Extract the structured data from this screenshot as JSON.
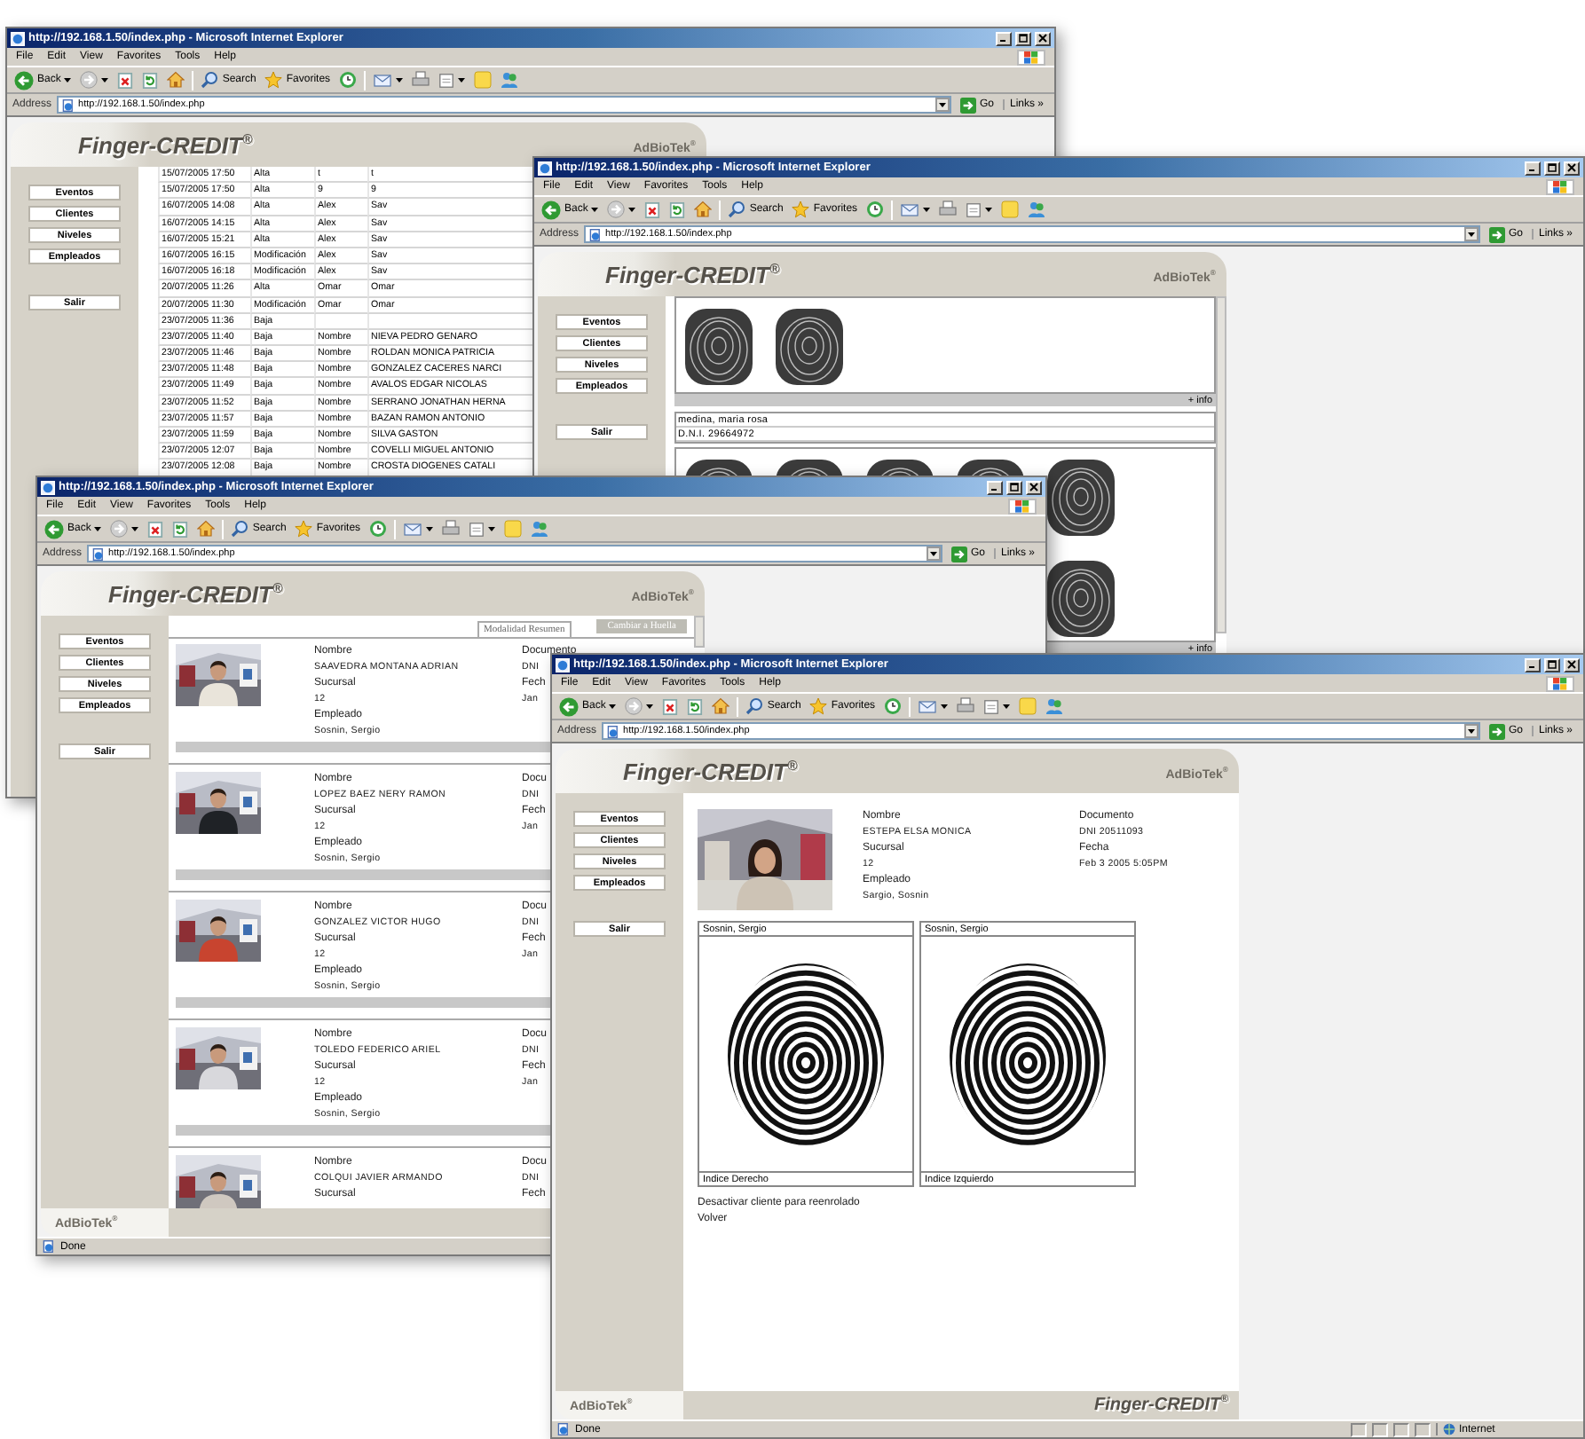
{
  "windows": [
    {
      "kind": "events",
      "title": "http://192.168.1.50/index.php - Microsoft Internet Explorer",
      "menu": [
        "File",
        "Edit",
        "View",
        "Favorites",
        "Tools",
        "Help"
      ],
      "toolbar": {
        "back": "Back",
        "search": "Search",
        "favorites": "Favorites"
      },
      "address": {
        "label": "Address",
        "url": "http://192.168.1.50/index.php",
        "go": "Go",
        "links": "Links »"
      },
      "brand": "Finger-CREDIT$^{®}$",
      "maker": "AdBioTek$^{®}$",
      "nav": [
        "Eventos",
        "Clientes",
        "Niveles",
        "Empleados"
      ],
      "logout": "Salir",
      "events": [
        [
          "15/07/2005 17:50",
          "Alta",
          "t",
          "t"
        ],
        [
          "15/07/2005 17:50",
          "Alta",
          "9",
          "9"
        ],
        [
          "16/07/2005 14:08",
          "Alta",
          "Alex",
          "Sav"
        ],
        [
          "16/07/2005 14:15",
          "Alta",
          "Alex",
          "Sav"
        ],
        [
          "16/07/2005 15:21",
          "Alta",
          "Alex",
          "Sav"
        ],
        [
          "16/07/2005 16:15",
          "Modificación",
          "Alex",
          "Sav"
        ],
        [
          "16/07/2005 16:18",
          "Modificación",
          "Alex",
          "Sav"
        ],
        [
          "20/07/2005 11:26",
          "Alta",
          "Omar",
          "Omar"
        ],
        [
          "20/07/2005 11:30",
          "Modificación",
          "Omar",
          "Omar"
        ],
        [
          "23/07/2005 11:36",
          "Baja"
        ],
        [
          "23/07/2005 11:40",
          "Baja",
          "Nombre",
          "NIEVA PEDRO GENARO"
        ],
        [
          "23/07/2005 11:46",
          "Baja",
          "Nombre",
          "ROLDAN MONICA PATRICIA"
        ],
        [
          "23/07/2005 11:48",
          "Baja",
          "Nombre",
          "GONZALEZ CACERES NARCI"
        ],
        [
          "23/07/2005 11:49",
          "Baja",
          "Nombre",
          "AVALOS EDGAR NICOLAS"
        ],
        [
          "23/07/2005 11:52",
          "Baja",
          "Nombre",
          "SERRANO JONATHAN HERNA"
        ],
        [
          "23/07/2005 11:57",
          "Baja",
          "Nombre",
          "BAZAN RAMON ANTONIO"
        ],
        [
          "23/07/2005 11:59",
          "Baja",
          "Nombre",
          "SILVA GASTON"
        ],
        [
          "23/07/2005 12:07",
          "Baja",
          "Nombre",
          "COVELLI MIGUEL ANTONIO"
        ],
        [
          "23/07/2005 12:08",
          "Baja",
          "Nombre",
          "CROSTA DIOGENES CATALI"
        ]
      ]
    },
    {
      "kind": "prints",
      "title": "http://192.168.1.50/index.php - Microsoft Internet Explorer",
      "menu": [
        "File",
        "Edit",
        "View",
        "Favorites",
        "Tools",
        "Help"
      ],
      "toolbar": {
        "back": "Back",
        "search": "Search",
        "favorites": "Favorites"
      },
      "address": {
        "label": "Address",
        "url": "http://192.168.1.50/index.php",
        "go": "Go",
        "links": "Links »"
      },
      "brand": "Finger-CREDIT$^{®}$",
      "maker": "AdBioTek$^{®}$",
      "nav": [
        "Eventos",
        "Clientes",
        "Niveles",
        "Empleados"
      ],
      "logout": "Salir",
      "sections": [
        {
          "kind": "print-pair",
          "more": "+ info"
        },
        {
          "kind": "person",
          "lines": [
            "medina, maria rosa",
            "D.N.I. 29664972"
          ]
        },
        {
          "kind": "print-set",
          "more": "+ info"
        }
      ]
    },
    {
      "kind": "clients",
      "title": "http://192.168.1.50/index.php - Microsoft Internet Explorer",
      "menu": [
        "File",
        "Edit",
        "View",
        "Favorites",
        "Tools",
        "Help"
      ],
      "toolbar": {
        "back": "Back",
        "search": "Search",
        "favorites": "Favorites"
      },
      "address": {
        "label": "Address",
        "url": "http://192.168.1.50/index.php",
        "go": "Go",
        "links": "Links »"
      },
      "brand": "Finger-CREDIT$^{®}$",
      "maker": "AdBioTek$^{®}$",
      "nav": [
        "Eventos",
        "Clientes",
        "Niveles",
        "Empleados"
      ],
      "logout": "Salir",
      "view_tab": "Modalidad Resumen",
      "switch": "Cambiar a Huella",
      "clients": [
        {
          "fields": [
            "Nombre",
            "SAAVEDRA MONTANA ADRIAN",
            "Sucursal",
            "12",
            "Empleado",
            "Sosnin, Sergio"
          ],
          "doc": [
            "Documento",
            "DNI",
            "Fech",
            "Jan"
          ]
        },
        {
          "fields": [
            "Nombre",
            "LOPEZ BAEZ NERY RAMON",
            "Sucursal",
            "12",
            "Empleado",
            "Sosnin, Sergio"
          ],
          "doc": [
            "Docu",
            "DNI",
            "Fech",
            "Jan"
          ]
        },
        {
          "fields": [
            "Nombre",
            "GONZALEZ VICTOR HUGO",
            "Sucursal",
            "12",
            "Empleado",
            "Sosnin, Sergio"
          ],
          "doc": [
            "Docu",
            "DNI",
            "Fech",
            "Jan"
          ]
        },
        {
          "fields": [
            "Nombre",
            "TOLEDO FEDERICO ARIEL",
            "Sucursal",
            "12",
            "Empleado",
            "Sosnin, Sergio"
          ],
          "doc": [
            "Docu",
            "DNI",
            "Fech",
            "Jan"
          ]
        },
        {
          "fields": [
            "Nombre",
            "COLQUI JAVIER ARMANDO",
            "Sucursal"
          ],
          "doc": [
            "Docu",
            "DNI",
            "Fech"
          ]
        }
      ],
      "footer": {
        "maker": "AdBioTek$^{®}$"
      },
      "status": {
        "text": "Done"
      }
    },
    {
      "kind": "client",
      "title": "http://192.168.1.50/index.php - Microsoft Internet Explorer",
      "menu": [
        "File",
        "Edit",
        "View",
        "Favorites",
        "Tools",
        "Help"
      ],
      "toolbar": {
        "back": "Back",
        "search": "Search",
        "favorites": "Favorites"
      },
      "address": {
        "label": "Address",
        "url": "http://192.168.1.50/index.php",
        "go": "Go",
        "links": "Links »"
      },
      "brand": "Finger-CREDIT$^{®}$",
      "maker": "AdBioTek$^{®}$",
      "nav": [
        "Eventos",
        "Clientes",
        "Niveles",
        "Empleados"
      ],
      "logout": "Salir",
      "client": {
        "fields": [
          "Nombre",
          "ESTEPA ELSA MONICA",
          "Sucursal",
          "12",
          "Empleado",
          "Sargio, Sosnin"
        ],
        "doc": [
          "Documento",
          "DNI 20511093",
          "Fecha",
          "Feb 3 2005 5:05PM"
        ]
      },
      "prints": [
        {
          "header": "Sosnin, Sergio",
          "footer": "Indice Derecho"
        },
        {
          "header": "Sosnin, Sergio",
          "footer": "Indice Izquierdo"
        }
      ],
      "actions": [
        "Desactivar cliente para reenrolado",
        "Volver"
      ],
      "footer": {
        "maker": "AdBioTek$^{®}$",
        "brand": "Finger-CREDIT$^{®}$"
      },
      "status": {
        "text": "Done",
        "zone": "Internet"
      }
    }
  ]
}
